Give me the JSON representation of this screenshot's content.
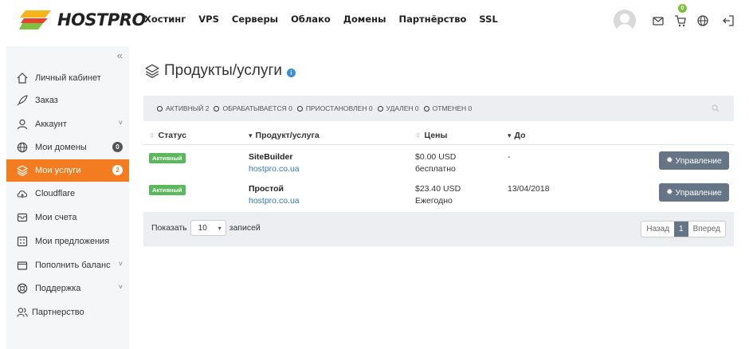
{
  "header": {
    "logo_text": "HOSTPRO",
    "nav": [
      "Хостинг",
      "VPS",
      "Серверы",
      "Облако",
      "Домены",
      "Партнёрство",
      "SSL"
    ],
    "cart_count": "0"
  },
  "sidebar": {
    "items": [
      {
        "label": "Личный кабинет",
        "icon": "home-icon"
      },
      {
        "label": "Заказ",
        "icon": "rocket-icon"
      },
      {
        "label": "Аккаунт",
        "icon": "user-icon",
        "chevron": "˅"
      },
      {
        "label": "Мои домены",
        "icon": "globe-icon",
        "count": "0"
      },
      {
        "label": "Мои услуги",
        "icon": "layers-icon",
        "count": "2",
        "active": true
      },
      {
        "label": "Cloudflare",
        "icon": "cloud-icon"
      },
      {
        "label": "Мои счета",
        "icon": "invoice-icon"
      },
      {
        "label": "Мои предложения",
        "icon": "quote-icon"
      },
      {
        "label": "Пополнить баланс",
        "icon": "wallet-icon",
        "chevron": "˅"
      },
      {
        "label": "Поддержка",
        "icon": "lifebuoy-icon",
        "chevron": "˅"
      },
      {
        "label": "Партнерство",
        "icon": "users-icon"
      }
    ]
  },
  "page": {
    "title": "Продукты/услуги"
  },
  "filters": [
    "АКТИВНЫЙ 2",
    "ОБРАБАТЫВАЕТСЯ 0",
    "ПРИОСТАНОВЛЕН 0",
    "УДАЛЕН 0",
    "ОТМЕНЕН 0"
  ],
  "table": {
    "headers": [
      "Статус",
      "Продукт/услуга",
      "Цены",
      "До"
    ],
    "rows": [
      {
        "status": "Активный",
        "product": "SiteBuilder",
        "domain": "hostpro.co.ua",
        "price": "$0.00 USD",
        "cycle": "бесплатно",
        "due": "-",
        "action": "Управление"
      },
      {
        "status": "Активный",
        "product": "Простой",
        "domain": "hostpro.co.ua",
        "price": "$23.40 USD",
        "cycle": "Ежегодно",
        "due": "13/04/2018",
        "action": "Управление"
      }
    ]
  },
  "footer": {
    "show_label": "Показать",
    "per_page": "10",
    "records_label": "записей",
    "prev": "Назад",
    "page": "1",
    "next": "Вперед"
  },
  "colors": {
    "accent": "#f47c20",
    "status_green": "#5cb85c",
    "button": "#667585",
    "link": "#337ab7"
  }
}
